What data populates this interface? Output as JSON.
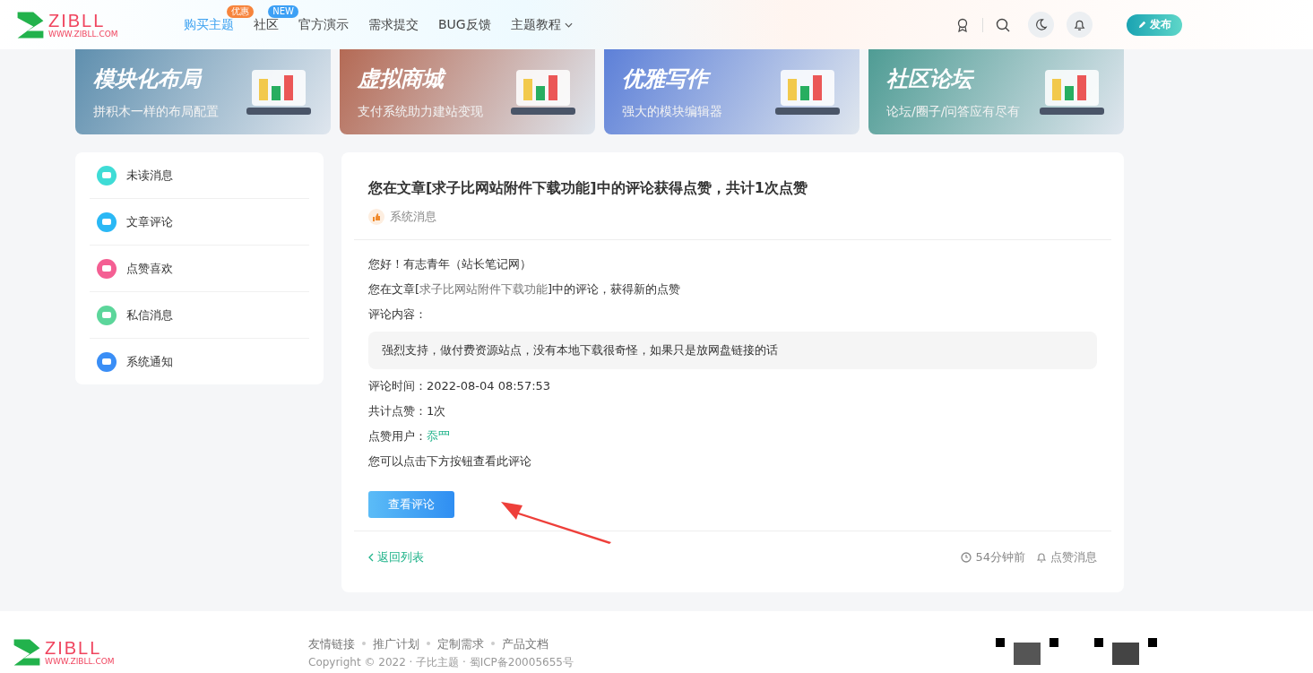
{
  "header": {
    "logo": {
      "text": "ZIBLL",
      "subtext": "WWW.ZIBLL.COM"
    },
    "nav": [
      {
        "label": "购买主题",
        "selected": true,
        "badge": {
          "text": "优惠",
          "color": "#f7843c"
        }
      },
      {
        "label": "社区",
        "selected": false,
        "badge": {
          "text": "NEW",
          "color": "#3da0f5"
        }
      },
      {
        "label": "官方演示",
        "selected": false
      },
      {
        "label": "需求提交",
        "selected": false
      },
      {
        "label": "BUG反馈",
        "selected": false
      },
      {
        "label": "主题教程",
        "selected": false,
        "has_menu": true
      }
    ],
    "publish_button": "发布"
  },
  "banners": [
    {
      "title": "模块化布局",
      "subtitle": "拼积木一样的布局配置",
      "color": "#5f8fae"
    },
    {
      "title": "虚拟商城",
      "subtitle": "支付系统助力建站变现",
      "color": "#b46a55"
    },
    {
      "title": "优雅写作",
      "subtitle": "强大的模块编辑器",
      "color": "#5d80d8"
    },
    {
      "title": "社区论坛",
      "subtitle": "论坛/圈子/问答应有尽有",
      "color": "#4f9c94"
    }
  ],
  "sidebar": {
    "items": [
      {
        "label": "未读消息",
        "color": "#3fdcd6"
      },
      {
        "label": "文章评论",
        "color": "#2ab8f5"
      },
      {
        "label": "点赞喜欢",
        "color": "#f45f93"
      },
      {
        "label": "私信消息",
        "color": "#5cd69b"
      },
      {
        "label": "系统通知",
        "color": "#3a8ef6"
      }
    ]
  },
  "message": {
    "title": "您在文章[求子比网站附件下载功能]中的评论获得点赞，共计1次点赞",
    "source": "系统消息",
    "body": [
      {
        "kind": "text",
        "text": "您好！有志青年（站长笔记网）"
      },
      {
        "kind": "link_line",
        "before": "您在文章[",
        "link": "求子比网站附件下载功能",
        "after": "]中的评论，获得新的点赞"
      },
      {
        "kind": "text",
        "text": "评论内容："
      },
      {
        "kind": "quote",
        "text": "强烈支持，做付费资源站点，没有本地下载很奇怪，如果只是放网盘链接的话"
      },
      {
        "kind": "text",
        "text": "评论时间：2022-08-04 08:57:53"
      },
      {
        "kind": "text",
        "text": "共计点赞：1次"
      },
      {
        "kind": "user_line",
        "before": "点赞用户：",
        "link": "忝罒"
      },
      {
        "kind": "text",
        "text": "您可以点击下方按钮查看此评论"
      }
    ],
    "button": "查看评论",
    "back": "返回列表",
    "time": "54分钟前",
    "type": "点赞消息"
  },
  "footer": {
    "logo": {
      "text": "ZIBLL",
      "subtext": "WWW.ZIBLL.COM"
    },
    "links": [
      "友情链接",
      "推广计划",
      "定制需求",
      "产品文档"
    ],
    "copyright": "Copyright © 2022 · 子比主题 · 蜀ICP备20005655号"
  }
}
